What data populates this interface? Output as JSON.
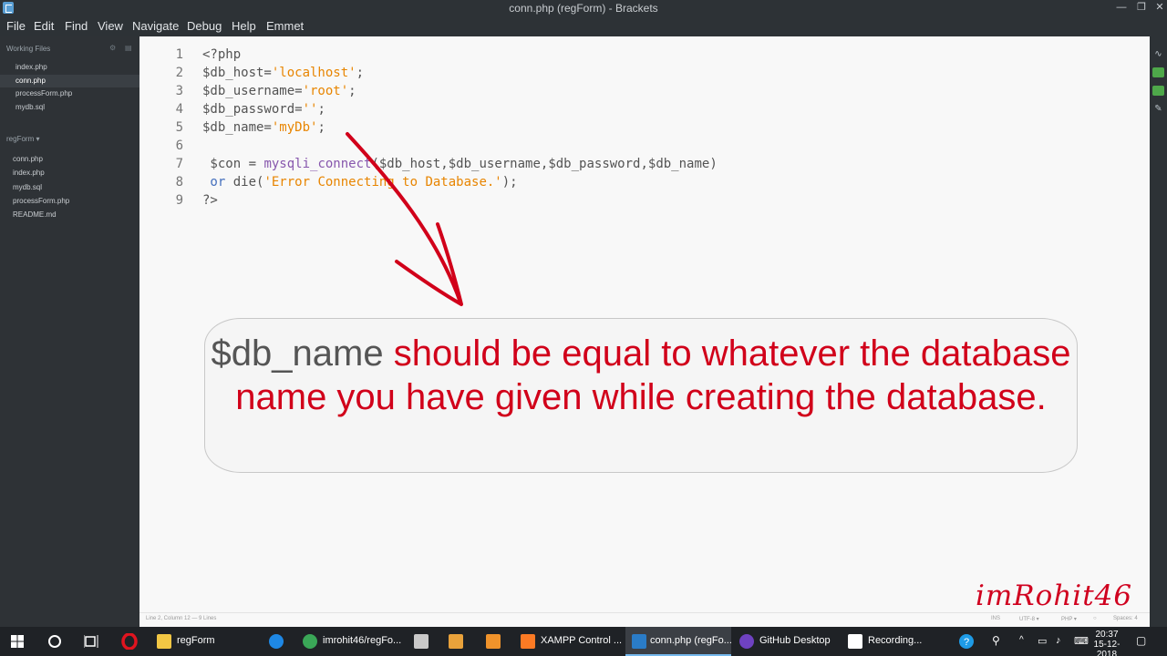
{
  "window": {
    "title": "conn.php (regForm) - Brackets",
    "controls": {
      "minimize": "—",
      "maximize": "❐",
      "close": "✕"
    }
  },
  "menu": [
    "File",
    "Edit",
    "Find",
    "View",
    "Navigate",
    "Debug",
    "Help",
    "Emmet"
  ],
  "sidebar": {
    "working_files_title": "Working Files",
    "working_files": [
      "index.php",
      "conn.php",
      "processForm.php",
      "mydb.sql"
    ],
    "selected_working_file": "conn.php",
    "project_title": "regForm ▾",
    "project_files": [
      "conn.php",
      "index.php",
      "mydb.sql",
      "processForm.php",
      "README.md"
    ]
  },
  "editor": {
    "line_numbers": [
      "1",
      "2",
      "3",
      "4",
      "5",
      "6",
      "7",
      "8",
      "9"
    ],
    "lines": [
      {
        "plain_a": "<?php"
      },
      {
        "plain_a": "$db_host=",
        "str": "'localhost'",
        "plain_b": ";"
      },
      {
        "plain_a": "$db_username=",
        "str": "'root'",
        "plain_b": ";"
      },
      {
        "plain_a": "$db_password=",
        "str": "''",
        "plain_b": ";"
      },
      {
        "plain_a": "$db_name=",
        "str": "'myDb'",
        "plain_b": ";"
      },
      {
        "plain_a": ""
      },
      {
        "plain_a": " $con = ",
        "fn": "mysqli_connect",
        "plain_b": "($db_host,$db_username,$db_password,$db_name)"
      },
      {
        "kw": " or ",
        "plain_a": "die(",
        "str": "'Error Connecting to Database.'",
        "plain_b": ");"
      },
      {
        "plain_a": "?>"
      }
    ]
  },
  "status": {
    "cursor": "Line 2, Column 12 — 9 Lines",
    "mode": "INS",
    "encoding": "UTF-8 ▾",
    "language": "PHP ▾",
    "spaces": "Spaces: 4"
  },
  "callout": {
    "dark_part": "$db_name",
    "red_part": " should be equal to whatever the database name you have given while creating the database."
  },
  "watermark": "imRohit46",
  "taskbar": {
    "items": [
      {
        "label": "regForm",
        "icon": "folder-icon",
        "color": "#f2c744"
      },
      {
        "label": "imrohit46/regFo...",
        "icon": "chrome-icon",
        "color": "#3aa757"
      },
      {
        "label": "XAMPP Control ...",
        "icon": "xampp-icon",
        "color": "#fb7a24"
      },
      {
        "label": "conn.php (regFo...",
        "icon": "brackets-icon",
        "color": "#2a7cc7"
      },
      {
        "label": "GitHub Desktop",
        "icon": "github-icon",
        "color": "#6f42c1"
      },
      {
        "label": "Recording...",
        "icon": "recorder-icon",
        "color": "#1b9a3b"
      }
    ],
    "clock_time": "20:37",
    "clock_date": "15-12-2018"
  },
  "colors": {
    "accent_red": "#d1001a",
    "string": "#e88501",
    "function": "#8757ad",
    "keyword": "#446fbd"
  }
}
